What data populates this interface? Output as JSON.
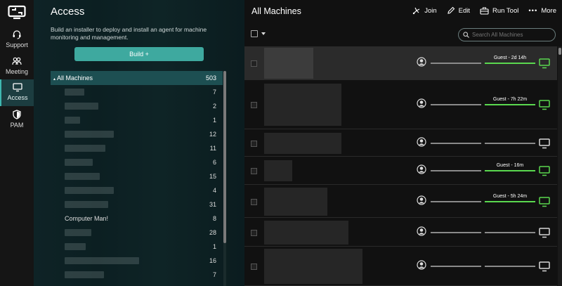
{
  "nav": {
    "items": [
      {
        "label": "Support",
        "icon": "headset-icon"
      },
      {
        "label": "Meeting",
        "icon": "people-icon"
      },
      {
        "label": "Access",
        "icon": "monitor-icon",
        "active": true
      },
      {
        "label": "PAM",
        "icon": "shield-icon"
      }
    ]
  },
  "access": {
    "title": "Access",
    "description": "Build an installer to deploy and install an agent for machine monitoring and management.",
    "build_label": "Build +",
    "tree_head": {
      "label": "All Machines",
      "count": "503"
    },
    "groups": [
      {
        "name": "",
        "count": "7"
      },
      {
        "name": "",
        "count": "2"
      },
      {
        "name": "",
        "count": "1"
      },
      {
        "name": "",
        "count": "12"
      },
      {
        "name": "",
        "count": "11"
      },
      {
        "name": "",
        "count": "6"
      },
      {
        "name": "",
        "count": "15"
      },
      {
        "name": "",
        "count": "4"
      },
      {
        "name": "",
        "count": "31"
      },
      {
        "name": "Computer Man!",
        "count": "8"
      },
      {
        "name": "",
        "count": "28"
      },
      {
        "name": "",
        "count": "1"
      },
      {
        "name": "",
        "count": "16"
      },
      {
        "name": "",
        "count": "7"
      }
    ]
  },
  "machines": {
    "title": "All Machines",
    "toolbar": {
      "join": "Join",
      "edit": "Edit",
      "run_tool": "Run Tool",
      "more": "More"
    },
    "search_placeholder": "Search All Machines",
    "rows": [
      {
        "guest": "Guest - 2d 14h",
        "online": true,
        "selected": true
      },
      {
        "guest": "Guest - 7h 22m",
        "online": true,
        "selected": false
      },
      {
        "guest": "",
        "online": false,
        "selected": false
      },
      {
        "guest": "Guest - 16m",
        "online": true,
        "selected": false
      },
      {
        "guest": "Guest - 5h 24m",
        "online": true,
        "selected": false
      },
      {
        "guest": "",
        "online": false,
        "selected": false
      },
      {
        "guest": "",
        "online": false,
        "selected": false
      }
    ]
  },
  "colors": {
    "accent": "#3ea99f",
    "online": "#5ad84f",
    "offline": "#d8d8d8"
  }
}
